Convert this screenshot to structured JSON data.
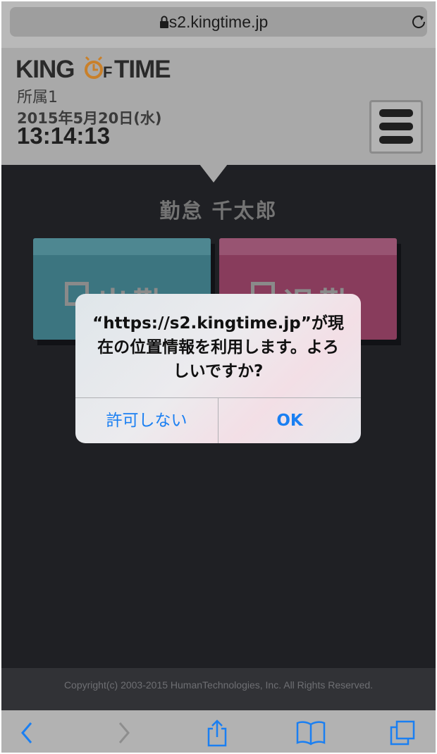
{
  "browser": {
    "url": "s2.kingtime.jp",
    "icons": [
      "lock-icon",
      "reload-icon"
    ]
  },
  "header": {
    "logo_text": "KING OF TIME",
    "affiliation": "所属1",
    "date": "2015年5月20日(水)",
    "time": "13:14:13",
    "menu_icon": "hamburger-menu-icon"
  },
  "main": {
    "employee_name": "勤怠 千太郎",
    "punch_in_label": "出勤",
    "punch_out_label": "退勤"
  },
  "alert": {
    "message": "“https://s2.kingtime.jp”が現在の位置情報を利用します。よろしいですか?",
    "deny_label": "許可しない",
    "ok_label": "OK"
  },
  "footer": {
    "copyright": "Copyright(c) 2003-2015 HumanTechnologies, Inc. All Rights Reserved."
  },
  "toolbar": {
    "icons": [
      "back-icon",
      "forward-icon",
      "share-icon",
      "bookmarks-icon",
      "tabs-icon"
    ]
  },
  "colors": {
    "page_background": "#1f2024",
    "header_background": "#a9a9a9",
    "punch_in": "#3c7580",
    "punch_out": "#883c5c",
    "link_blue": "#1a7ff2",
    "logo_accent": "#c9802a"
  }
}
